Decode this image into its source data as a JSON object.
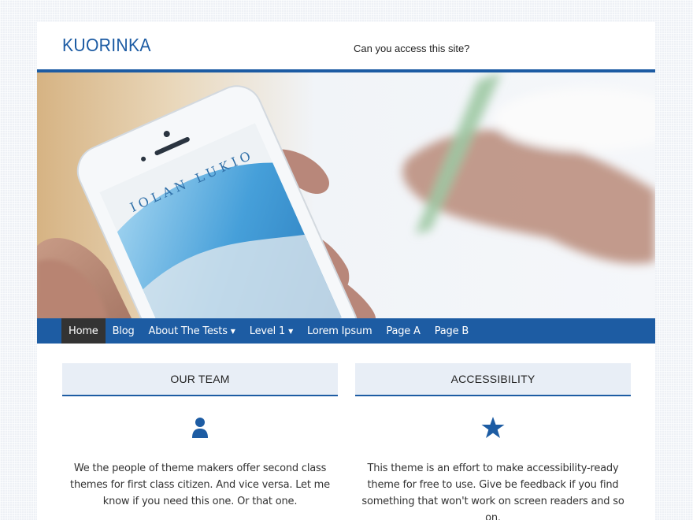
{
  "site": {
    "title": "KUORINKA",
    "description": "Can you access this site?"
  },
  "hero": {
    "phone_text": "IOLAN LUKIO"
  },
  "nav": {
    "items": [
      {
        "label": "Home"
      },
      {
        "label": "Blog"
      },
      {
        "label": "About The Tests"
      },
      {
        "label": "Level 1"
      },
      {
        "label": "Lorem Ipsum"
      },
      {
        "label": "Page A"
      },
      {
        "label": "Page B"
      }
    ]
  },
  "widgets": [
    {
      "title": "OUR TEAM",
      "icon": "person-icon",
      "text": "We the people of theme makers offer second class themes for first class citizen. And vice versa. Let me know if you need this one. Or that one."
    },
    {
      "title": "ACCESSIBILITY",
      "icon": "star-icon",
      "text": "This theme is an effort to make accessibility-ready theme for free to use. Give be feedback if you find something that won't work on screen readers and so on."
    }
  ],
  "colors": {
    "accent": "#1d5ca3",
    "active_nav": "#333333",
    "widget_bg": "#e8eef6"
  }
}
